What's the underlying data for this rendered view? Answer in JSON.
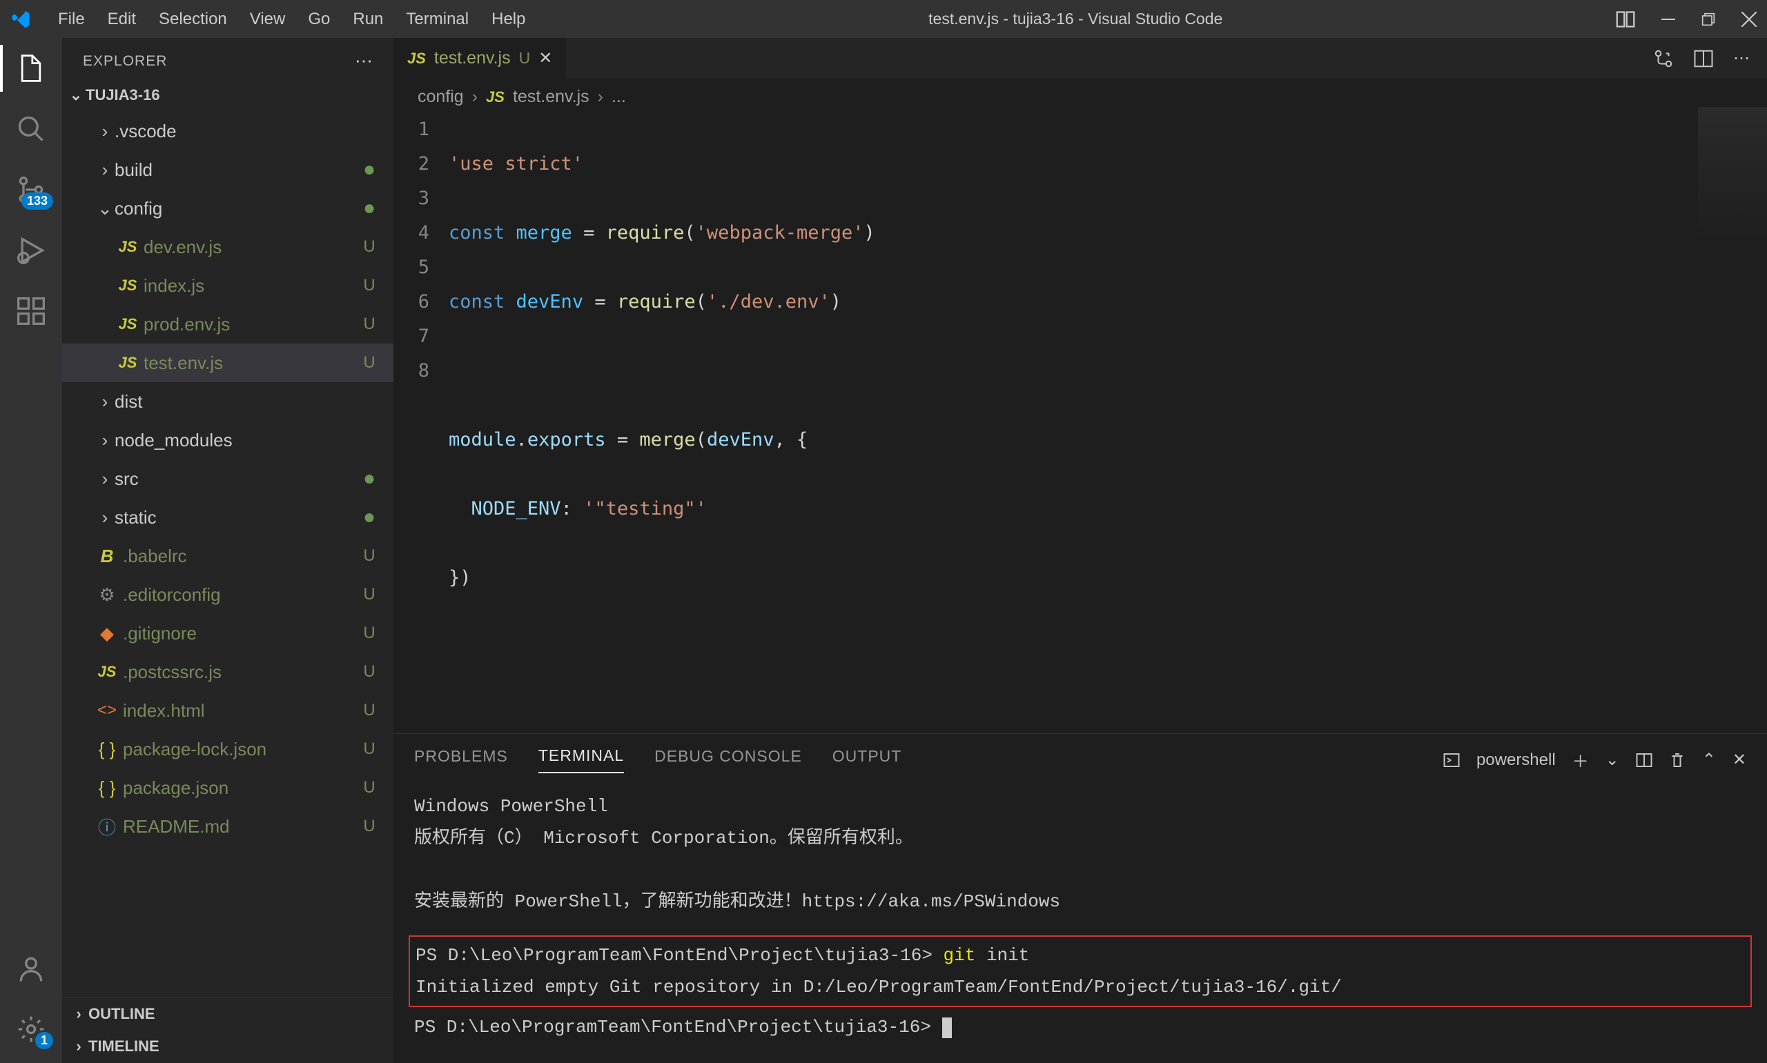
{
  "titlebar": {
    "menus": [
      "File",
      "Edit",
      "Selection",
      "View",
      "Go",
      "Run",
      "Terminal",
      "Help"
    ],
    "title": "test.env.js - tujia3-16 - Visual Studio Code"
  },
  "activitybar": {
    "scm_badge": "133",
    "settings_badge": "1"
  },
  "sidebar": {
    "header": "EXPLORER",
    "root": "TUJIA3-16",
    "tree": [
      {
        "type": "folder",
        "name": ".vscode",
        "indent": 1,
        "expanded": false,
        "status": ""
      },
      {
        "type": "folder",
        "name": "build",
        "indent": 1,
        "expanded": false,
        "status": "dot"
      },
      {
        "type": "folder",
        "name": "config",
        "indent": 1,
        "expanded": true,
        "status": "dot"
      },
      {
        "type": "file",
        "name": "dev.env.js",
        "indent": 2,
        "icon": "js",
        "status": "U"
      },
      {
        "type": "file",
        "name": "index.js",
        "indent": 2,
        "icon": "js",
        "status": "U"
      },
      {
        "type": "file",
        "name": "prod.env.js",
        "indent": 2,
        "icon": "js",
        "status": "U"
      },
      {
        "type": "file",
        "name": "test.env.js",
        "indent": 2,
        "icon": "js",
        "status": "U",
        "selected": true
      },
      {
        "type": "folder",
        "name": "dist",
        "indent": 1,
        "expanded": false,
        "status": ""
      },
      {
        "type": "folder",
        "name": "node_modules",
        "indent": 1,
        "expanded": false,
        "status": ""
      },
      {
        "type": "folder",
        "name": "src",
        "indent": 1,
        "expanded": false,
        "status": "dot"
      },
      {
        "type": "folder",
        "name": "static",
        "indent": 1,
        "expanded": false,
        "status": "dot"
      },
      {
        "type": "file",
        "name": ".babelrc",
        "indent": 1,
        "icon": "babel",
        "status": "U"
      },
      {
        "type": "file",
        "name": ".editorconfig",
        "indent": 1,
        "icon": "gear",
        "status": "U"
      },
      {
        "type": "file",
        "name": ".gitignore",
        "indent": 1,
        "icon": "git",
        "status": "U"
      },
      {
        "type": "file",
        "name": ".postcssrc.js",
        "indent": 1,
        "icon": "js",
        "status": "U"
      },
      {
        "type": "file",
        "name": "index.html",
        "indent": 1,
        "icon": "html",
        "status": "U"
      },
      {
        "type": "file",
        "name": "package-lock.json",
        "indent": 1,
        "icon": "json",
        "status": "U"
      },
      {
        "type": "file",
        "name": "package.json",
        "indent": 1,
        "icon": "json",
        "status": "U"
      },
      {
        "type": "file",
        "name": "README.md",
        "indent": 1,
        "icon": "info",
        "status": "U"
      }
    ],
    "outline": "OUTLINE",
    "timeline": "TIMELINE"
  },
  "editor": {
    "tab": {
      "name": "test.env.js",
      "status": "U"
    },
    "breadcrumbs": [
      "config",
      "test.env.js",
      "..."
    ],
    "lines": [
      "1",
      "2",
      "3",
      "4",
      "5",
      "6",
      "7",
      "8"
    ]
  },
  "code": {
    "l1_str": "'use strict'",
    "l2_kw": "const",
    "l2_var": " merge",
    "l2_eq": " = ",
    "l2_fn": "require",
    "l2_paren": "(",
    "l2_arg": "'webpack-merge'",
    "l2_close": ")",
    "l3_kw": "const",
    "l3_var": " devEnv",
    "l3_eq": " = ",
    "l3_fn": "require",
    "l3_paren": "(",
    "l3_arg": "'./dev.env'",
    "l3_close": ")",
    "l5_a": "module",
    "l5_b": ".",
    "l5_c": "exports",
    "l5_d": " = ",
    "l5_e": "merge",
    "l5_f": "(",
    "l5_g": "devEnv",
    "l5_h": ", {",
    "l6_indent": "  ",
    "l6_key": "NODE_ENV",
    "l6_colon": ": ",
    "l6_val": "'\"testing\"'",
    "l7": "})"
  },
  "panel": {
    "tabs": [
      "PROBLEMS",
      "TERMINAL",
      "DEBUG CONSOLE",
      "OUTPUT"
    ],
    "shell": "powershell",
    "content": {
      "l1": "Windows PowerShell",
      "l2": "版权所有（C） Microsoft Corporation。保留所有权利。",
      "l3a": "安装最新的 PowerShell，了解新功能和改进！",
      "l3b": "https://aka.ms/PSWindows",
      "prompt1a": "PS D:\\Leo\\ProgramTeam\\FontEnd\\Project\\tujia3-16> ",
      "prompt1b": "git",
      "prompt1c": " init",
      "result": "Initialized empty Git repository in D:/Leo/ProgramTeam/FontEnd/Project/tujia3-16/.git/",
      "prompt2": "PS D:\\Leo\\ProgramTeam\\FontEnd\\Project\\tujia3-16> "
    }
  }
}
